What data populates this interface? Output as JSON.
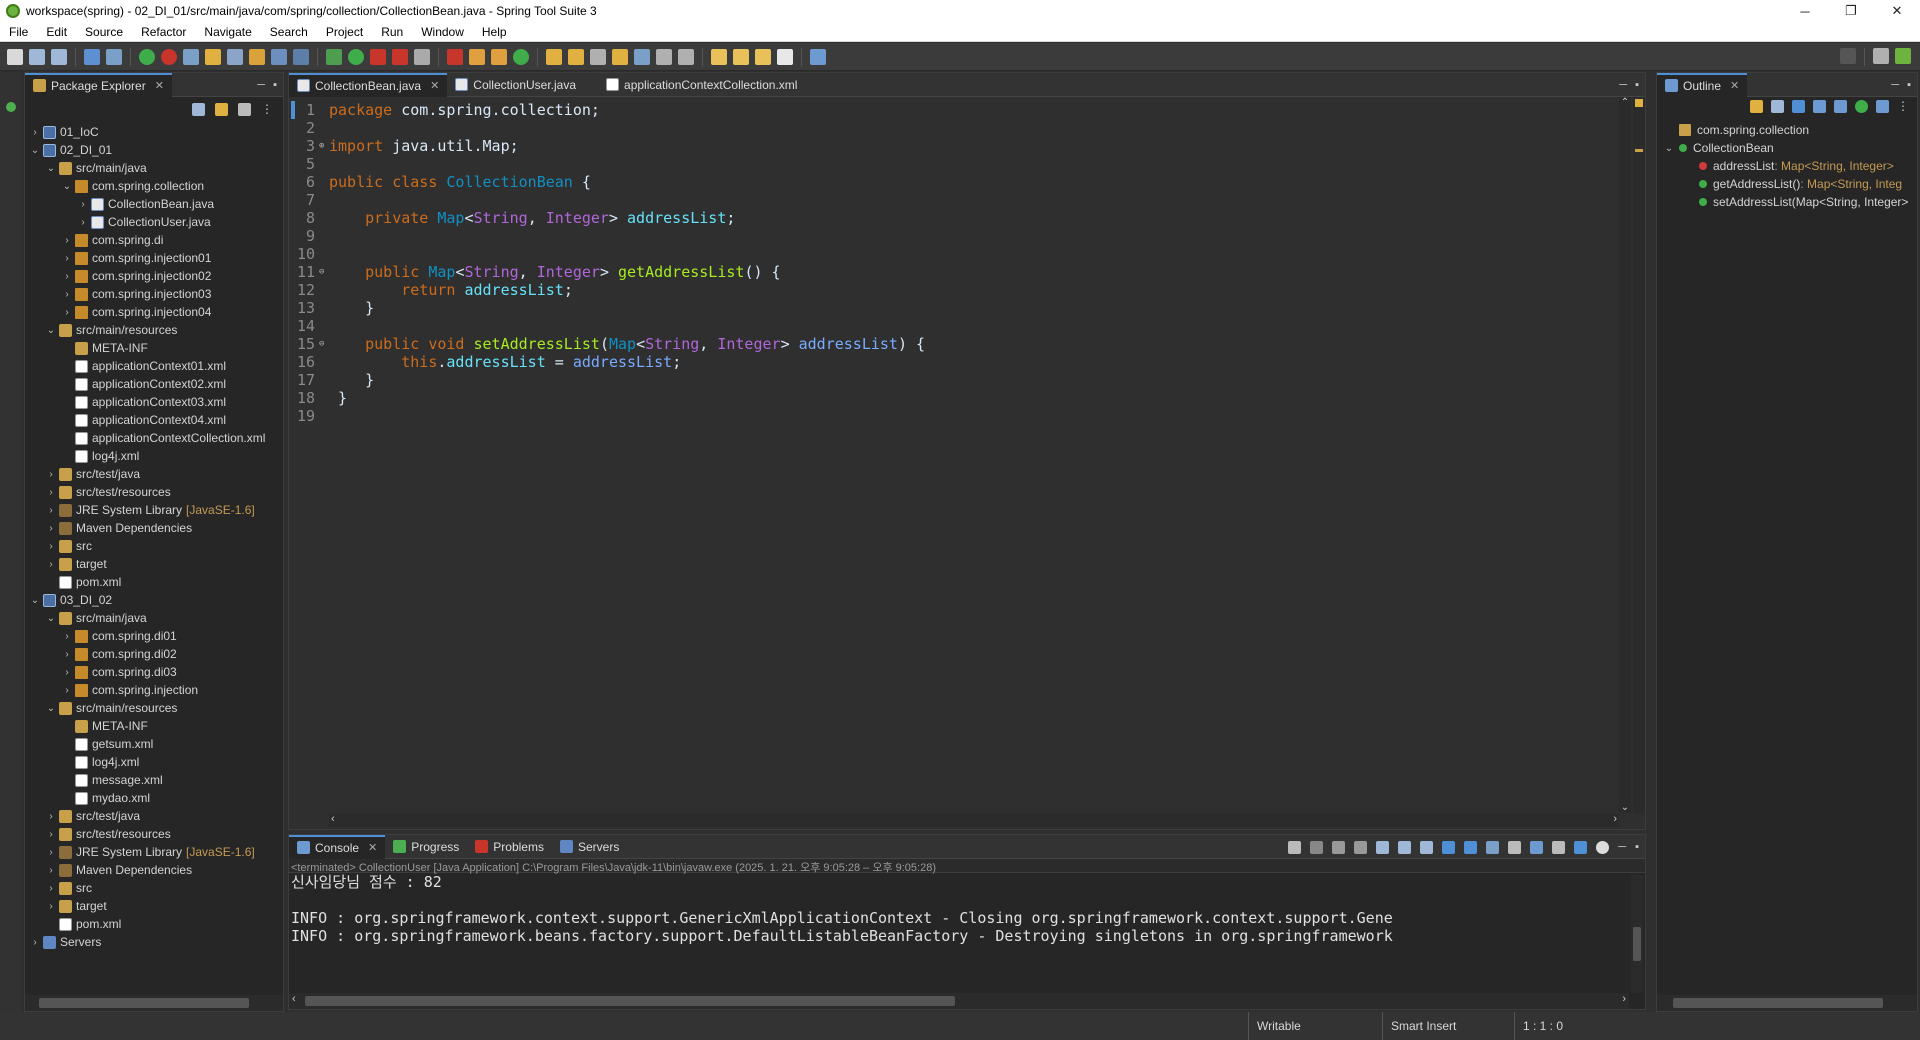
{
  "window": {
    "title": "workspace(spring) - 02_DI_01/src/main/java/com/spring/collection/CollectionBean.java - Spring Tool Suite 3",
    "minimize": "─",
    "maximize": "❐",
    "close": "✕"
  },
  "menu": [
    "File",
    "Edit",
    "Source",
    "Refactor",
    "Navigate",
    "Search",
    "Project",
    "Run",
    "Window",
    "Help"
  ],
  "package_explorer": {
    "tab_label": "Package Explorer",
    "items": [
      {
        "label": "01_IoC",
        "icon": "project-icon",
        "arrow": "›",
        "depth": 0
      },
      {
        "label": "02_DI_01",
        "icon": "project-icon",
        "arrow": "⌄",
        "depth": 0
      },
      {
        "label": "src/main/java",
        "icon": "source-folder-icon",
        "arrow": "⌄",
        "depth": 1
      },
      {
        "label": "com.spring.collection",
        "icon": "package-icon",
        "arrow": "⌄",
        "depth": 2
      },
      {
        "label": "CollectionBean.java",
        "icon": "java-file-icon",
        "arrow": "›",
        "depth": 3
      },
      {
        "label": "CollectionUser.java",
        "icon": "java-file-icon",
        "arrow": "›",
        "depth": 3
      },
      {
        "label": "com.spring.di",
        "icon": "package-icon",
        "arrow": "›",
        "depth": 2
      },
      {
        "label": "com.spring.injection01",
        "icon": "package-icon",
        "arrow": "›",
        "depth": 2
      },
      {
        "label": "com.spring.injection02",
        "icon": "package-icon",
        "arrow": "›",
        "depth": 2
      },
      {
        "label": "com.spring.injection03",
        "icon": "package-icon",
        "arrow": "›",
        "depth": 2
      },
      {
        "label": "com.spring.injection04",
        "icon": "package-icon",
        "arrow": "›",
        "depth": 2
      },
      {
        "label": "src/main/resources",
        "icon": "source-folder-icon",
        "arrow": "⌄",
        "depth": 1
      },
      {
        "label": "META-INF",
        "icon": "folder-icon",
        "arrow": "",
        "depth": 2
      },
      {
        "label": "applicationContext01.xml",
        "icon": "xml-file-icon",
        "arrow": "",
        "depth": 2
      },
      {
        "label": "applicationContext02.xml",
        "icon": "xml-file-icon",
        "arrow": "",
        "depth": 2
      },
      {
        "label": "applicationContext03.xml",
        "icon": "xml-file-icon",
        "arrow": "",
        "depth": 2
      },
      {
        "label": "applicationContext04.xml",
        "icon": "xml-file-icon",
        "arrow": "",
        "depth": 2
      },
      {
        "label": "applicationContextCollection.xml",
        "icon": "xml-file-icon",
        "arrow": "",
        "depth": 2
      },
      {
        "label": "log4j.xml",
        "icon": "xml-file-icon",
        "arrow": "",
        "depth": 2
      },
      {
        "label": "src/test/java",
        "icon": "source-folder-icon",
        "arrow": "›",
        "depth": 1
      },
      {
        "label": "src/test/resources",
        "icon": "source-folder-icon",
        "arrow": "›",
        "depth": 1
      },
      {
        "label": "JRE System Library",
        "decoration": "[JavaSE-1.6]",
        "icon": "library-icon",
        "arrow": "›",
        "depth": 1
      },
      {
        "label": "Maven Dependencies",
        "icon": "library-icon",
        "arrow": "›",
        "depth": 1
      },
      {
        "label": "src",
        "icon": "folder-icon",
        "arrow": "›",
        "depth": 1
      },
      {
        "label": "target",
        "icon": "folder-icon",
        "arrow": "›",
        "depth": 1
      },
      {
        "label": "pom.xml",
        "icon": "xml-file-icon",
        "arrow": "",
        "depth": 1
      },
      {
        "label": "03_DI_02",
        "icon": "project-icon",
        "arrow": "⌄",
        "depth": 0
      },
      {
        "label": "src/main/java",
        "icon": "source-folder-icon",
        "arrow": "⌄",
        "depth": 1
      },
      {
        "label": "com.spring.di01",
        "icon": "package-icon",
        "arrow": "›",
        "depth": 2
      },
      {
        "label": "com.spring.di02",
        "icon": "package-icon",
        "arrow": "›",
        "depth": 2
      },
      {
        "label": "com.spring.di03",
        "icon": "package-icon",
        "arrow": "›",
        "depth": 2
      },
      {
        "label": "com.spring.injection",
        "icon": "package-icon",
        "arrow": "›",
        "depth": 2
      },
      {
        "label": "src/main/resources",
        "icon": "source-folder-icon",
        "arrow": "⌄",
        "depth": 1
      },
      {
        "label": "META-INF",
        "icon": "folder-icon",
        "arrow": "",
        "depth": 2
      },
      {
        "label": "getsum.xml",
        "icon": "xml-file-icon",
        "arrow": "",
        "depth": 2
      },
      {
        "label": "log4j.xml",
        "icon": "xml-file-icon",
        "arrow": "",
        "depth": 2
      },
      {
        "label": "message.xml",
        "icon": "xml-file-icon",
        "arrow": "",
        "depth": 2
      },
      {
        "label": "mydao.xml",
        "icon": "xml-file-icon",
        "arrow": "",
        "depth": 2
      },
      {
        "label": "src/test/java",
        "icon": "source-folder-icon",
        "arrow": "›",
        "depth": 1
      },
      {
        "label": "src/test/resources",
        "icon": "source-folder-icon",
        "arrow": "›",
        "depth": 1
      },
      {
        "label": "JRE System Library",
        "decoration": "[JavaSE-1.6]",
        "icon": "library-icon",
        "arrow": "›",
        "depth": 1
      },
      {
        "label": "Maven Dependencies",
        "icon": "library-icon",
        "arrow": "›",
        "depth": 1
      },
      {
        "label": "src",
        "icon": "folder-icon",
        "arrow": "›",
        "depth": 1
      },
      {
        "label": "target",
        "icon": "folder-icon",
        "arrow": "›",
        "depth": 1
      },
      {
        "label": "pom.xml",
        "icon": "xml-file-icon",
        "arrow": "",
        "depth": 1
      },
      {
        "label": "Servers",
        "icon": "servers-icon",
        "arrow": "›",
        "depth": 0
      }
    ]
  },
  "editor": {
    "tabs": [
      {
        "label": "CollectionBean.java",
        "active": true
      },
      {
        "label": "CollectionUser.java",
        "active": false
      },
      {
        "label": "applicationContextCollection.xml",
        "active": false
      }
    ],
    "lines": [
      {
        "n": "1",
        "fold": "",
        "t": [
          [
            "kw",
            "package"
          ],
          [
            "",
            "&nbsp;com.spring.collection;"
          ]
        ]
      },
      {
        "n": "2",
        "fold": "",
        "t": []
      },
      {
        "n": "3",
        "fold": "⊕",
        "t": [
          [
            "kw",
            "import"
          ],
          [
            "",
            "&nbsp;java.util.Map;"
          ]
        ]
      },
      {
        "n": "5",
        "fold": "",
        "t": []
      },
      {
        "n": "6",
        "fold": "",
        "t": [
          [
            "kw",
            "public"
          ],
          [
            "",
            "&nbsp;"
          ],
          [
            "kw",
            "class"
          ],
          [
            "",
            "&nbsp;"
          ],
          [
            "cls",
            "CollectionBean"
          ],
          [
            "",
            "&nbsp;{"
          ]
        ]
      },
      {
        "n": "7",
        "fold": "",
        "t": []
      },
      {
        "n": "8",
        "fold": "",
        "t": [
          [
            "",
            "&nbsp;&nbsp;&nbsp;&nbsp;"
          ],
          [
            "kw",
            "private"
          ],
          [
            "",
            "&nbsp;"
          ],
          [
            "type",
            "Map"
          ],
          [
            "",
            "<"
          ],
          [
            "gen",
            "String"
          ],
          [
            "",
            ",&nbsp;"
          ],
          [
            "gen",
            "Integer"
          ],
          [
            "",
            ">&nbsp;"
          ],
          [
            "fld",
            "addressList"
          ],
          [
            "",
            ";"
          ]
        ]
      },
      {
        "n": "9",
        "fold": "",
        "t": []
      },
      {
        "n": "10",
        "fold": "",
        "t": []
      },
      {
        "n": "11",
        "fold": "⊖",
        "t": [
          [
            "",
            "&nbsp;&nbsp;&nbsp;&nbsp;"
          ],
          [
            "kw",
            "public"
          ],
          [
            "",
            "&nbsp;"
          ],
          [
            "type",
            "Map"
          ],
          [
            "",
            "<"
          ],
          [
            "gen",
            "String"
          ],
          [
            "",
            ",&nbsp;"
          ],
          [
            "gen",
            "Integer"
          ],
          [
            "",
            ">&nbsp;"
          ],
          [
            "meth",
            "getAddressList"
          ],
          [
            "",
            "()&nbsp;{"
          ]
        ]
      },
      {
        "n": "12",
        "fold": "",
        "t": [
          [
            "",
            "&nbsp;&nbsp;&nbsp;&nbsp;&nbsp;&nbsp;&nbsp;&nbsp;"
          ],
          [
            "kw",
            "return"
          ],
          [
            "",
            "&nbsp;"
          ],
          [
            "fld",
            "addressList"
          ],
          [
            "",
            ";"
          ]
        ]
      },
      {
        "n": "13",
        "fold": "",
        "t": [
          [
            "",
            "&nbsp;&nbsp;&nbsp;&nbsp;}"
          ]
        ]
      },
      {
        "n": "14",
        "fold": "",
        "t": []
      },
      {
        "n": "15",
        "fold": "⊖",
        "t": [
          [
            "",
            "&nbsp;&nbsp;&nbsp;&nbsp;"
          ],
          [
            "kw",
            "public"
          ],
          [
            "",
            "&nbsp;"
          ],
          [
            "kw",
            "void"
          ],
          [
            "",
            "&nbsp;"
          ],
          [
            "meth",
            "setAddressList"
          ],
          [
            "",
            "("
          ],
          [
            "type",
            "Map"
          ],
          [
            "",
            "<"
          ],
          [
            "gen",
            "String"
          ],
          [
            "",
            ",&nbsp;"
          ],
          [
            "gen",
            "Integer"
          ],
          [
            "",
            ">&nbsp;"
          ],
          [
            "param",
            "addressList"
          ],
          [
            "",
            ")&nbsp;{"
          ]
        ]
      },
      {
        "n": "16",
        "fold": "",
        "t": [
          [
            "",
            "&nbsp;&nbsp;&nbsp;&nbsp;&nbsp;&nbsp;&nbsp;&nbsp;"
          ],
          [
            "kw",
            "this"
          ],
          [
            "",
            "."
          ],
          [
            "fld",
            "addressList"
          ],
          [
            "",
            "&nbsp;=&nbsp;"
          ],
          [
            "param",
            "addressList"
          ],
          [
            "",
            ";"
          ]
        ]
      },
      {
        "n": "17",
        "fold": "",
        "t": [
          [
            "",
            "&nbsp;&nbsp;&nbsp;&nbsp;}"
          ]
        ]
      },
      {
        "n": "18",
        "fold": "",
        "t": [
          [
            "",
            "&nbsp;}"
          ]
        ]
      },
      {
        "n": "19",
        "fold": "",
        "t": []
      }
    ]
  },
  "outline": {
    "tab_label": "Outline",
    "items": [
      {
        "label": "com.spring.collection",
        "type": "",
        "icon": "package-decl-icon",
        "depth": 0,
        "arrow": ""
      },
      {
        "label": "CollectionBean",
        "type": "",
        "icon": "class-icon",
        "depth": 0,
        "arrow": "⌄"
      },
      {
        "label": "addressList",
        "type": " : Map<String, Integer>",
        "icon": "private-field-icon",
        "depth": 1,
        "arrow": ""
      },
      {
        "label": "getAddressList()",
        "type": " : Map<String, Integ",
        "icon": "public-method-icon",
        "depth": 1,
        "arrow": ""
      },
      {
        "label": "setAddressList(Map<String, Integer>",
        "type": "",
        "icon": "public-method-icon",
        "depth": 1,
        "arrow": ""
      }
    ]
  },
  "console": {
    "tabs": [
      "Console",
      "Progress",
      "Problems",
      "Servers"
    ],
    "status": "<terminated> CollectionUser [Java Application] C:\\Program Files\\Java\\jdk-11\\bin\\javaw.exe  (2025. 1. 21. 오후 9:05:28 – 오후 9:05:28)",
    "lines": [
      "신사임당님 점수 : 82",
      "",
      "INFO : org.springframework.context.support.GenericXmlApplicationContext - Closing org.springframework.context.support.Gene",
      "INFO : org.springframework.beans.factory.support.DefaultListableBeanFactory - Destroying singletons in org.springframework"
    ]
  },
  "statusbar": {
    "writable": "Writable",
    "insert_mode": "Smart Insert",
    "position": "1 : 1 : 0"
  },
  "colors": {
    "keyword": "#cc6c1d",
    "type": "#1290c3",
    "field": "#66e1f8",
    "method": "#a7ec21",
    "active_tab_accent": "#4e8fd6"
  }
}
